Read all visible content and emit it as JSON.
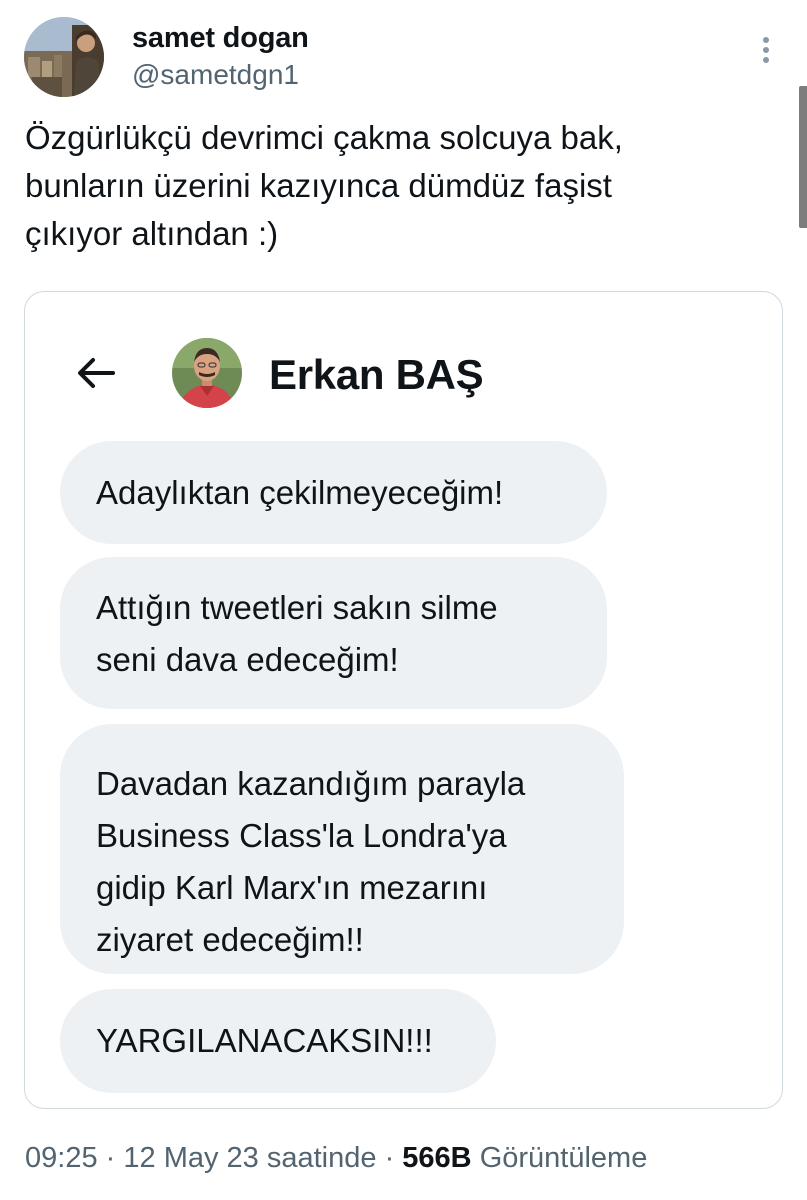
{
  "author": {
    "display_name": "samet dogan",
    "handle": "@sametdgn1",
    "avatar_icon": "profile-photo"
  },
  "tweet": {
    "text_lines": [
      "Özgürlükçü devrimci çakma solcuya bak,",
      "bunların üzerini kazıyınca dümdüz faşist",
      "çıkıyor altından :)"
    ]
  },
  "media": {
    "header": {
      "back_icon": "arrow-left-icon",
      "contact_name": "Erkan BAŞ"
    },
    "messages": [
      {
        "lines": [
          "Adaylıktan çekilmeyeceğim!"
        ]
      },
      {
        "lines": [
          "Attığın tweetleri sakın silme",
          "seni dava edeceğim!"
        ]
      },
      {
        "lines": [
          "Davadan kazandığım parayla",
          "Business Class'la Londra'ya",
          "gidip Karl Marx'ın mezarını",
          "ziyaret edeceğim!!"
        ]
      },
      {
        "lines": [
          "YARGILANACAKSIN!!!"
        ]
      }
    ]
  },
  "meta": {
    "time": "09:25",
    "separator": "·",
    "date": "12 May 23 saatinde",
    "views_count": "566B",
    "views_label": "Görüntüleme"
  },
  "colors": {
    "text_primary": "#0f1419",
    "text_secondary": "#536471",
    "bubble_background": "#eef1f4",
    "card_border": "#cfd9de"
  }
}
